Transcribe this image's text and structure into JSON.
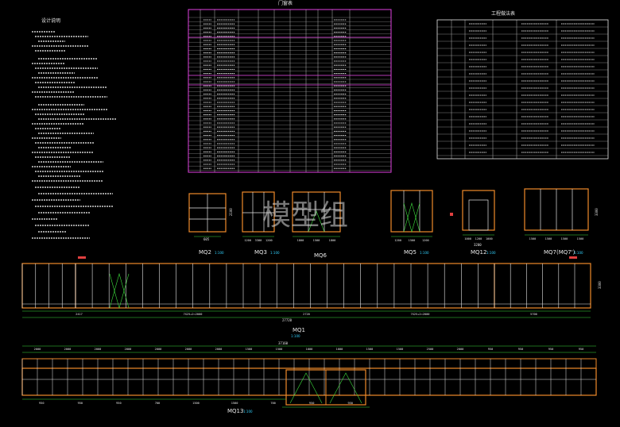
{
  "watermark": "模型组",
  "notes": {
    "title": "设计说明"
  },
  "door_table": {
    "title": "门窗表"
  },
  "spec_table": {
    "title": "工程做法表"
  },
  "elevations": {
    "mq2": {
      "label": "MQ2",
      "scale": "1:100",
      "width": "605",
      "height": "2100"
    },
    "mq3": {
      "label": "MQ3",
      "scale": "1:100",
      "dims": [
        "1200",
        "3300",
        "1200"
      ]
    },
    "mq6": {
      "label": "MQ6",
      "scale": "1:100",
      "dims": [
        "1800",
        "1500",
        "1800"
      ]
    },
    "mq5": {
      "label": "MQ5",
      "scale": "1:100",
      "dims": [
        "1200",
        "1500",
        "1200"
      ]
    },
    "mq12": {
      "label": "MQ12",
      "scale": "1:100",
      "dims": [
        "1000",
        "1200",
        "1000"
      ],
      "total": "3200"
    },
    "mq7": {
      "label": "MQ7(MQ7')",
      "scale": "1:100",
      "dims": [
        "1500",
        "1500",
        "1500",
        "1500"
      ],
      "height": "3300"
    }
  },
  "mq1": {
    "label": "MQ1",
    "scale": "1:100",
    "total_width": "27720",
    "segments": [
      "2417",
      "7X25+2=2000",
      "2720",
      "7X25+2=2000",
      "5700"
    ],
    "height": "3300"
  },
  "mq13": {
    "label": "MQ13",
    "scale": "1:100",
    "total_width": "37160",
    "top_dims": [
      "2000",
      "2000",
      "2000",
      "2000",
      "2000",
      "2000",
      "2000",
      "1500",
      "1500",
      "1000",
      "1000",
      "1500",
      "1500",
      "2500",
      "2000",
      "950",
      "950",
      "950",
      "950"
    ],
    "bottom_dims": [
      "950",
      "950",
      "950",
      "700",
      "1500",
      "1500",
      "700",
      "950",
      "950"
    ]
  },
  "colors": {
    "frame_orange": "#f08a2a",
    "mullion_white": "#e6e6e6",
    "table_magenta": "#e040e0",
    "dim_green": "#3ddc3d",
    "text_white": "#e8e8e8",
    "label_cyan": "#32d2ff"
  }
}
